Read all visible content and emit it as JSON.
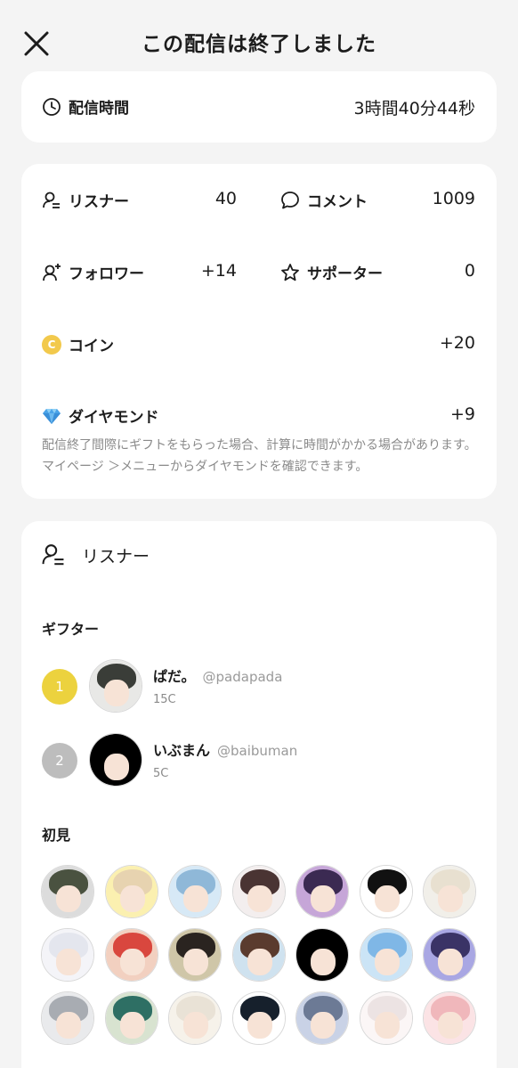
{
  "header": {
    "title": "この配信は終了しました"
  },
  "duration": {
    "label": "配信時間",
    "value": "3時間40分44秒"
  },
  "stats": {
    "listeners": {
      "label": "リスナー",
      "value": "40"
    },
    "comments": {
      "label": "コメント",
      "value": "1009"
    },
    "followers": {
      "label": "フォロワー",
      "value": "+14"
    },
    "supporters": {
      "label": "サポーター",
      "value": "0"
    },
    "coins": {
      "label": "コイン",
      "value": "+20",
      "icon_letter": "C"
    },
    "diamonds": {
      "label": "ダイヤモンド",
      "value": "+9"
    },
    "note": "配信終了間際にギフトをもらった場合、計算に時間がかかる場合があります。マイページ ＞メニューからダイヤモンドを確認できます。"
  },
  "listeners_section": {
    "title": "リスナー",
    "gifters_heading": "ギフター",
    "gifters": [
      {
        "rank": "1",
        "name": "ぱだ。",
        "handle": "@padapada",
        "coins": "15C",
        "rank_color": "#ecd23e",
        "hair_color": "#3a3d38"
      },
      {
        "rank": "2",
        "name": "いぶまん",
        "handle": "@baibuman",
        "coins": "5C",
        "rank_color": "#bdbdbd",
        "hair_color": "#000000"
      }
    ],
    "first_time_heading": "初見",
    "first_time_avatars": [
      {
        "hair": "#4a5240",
        "bg": "#dcdcdc"
      },
      {
        "hair": "#e7d3b0",
        "bg": "#fbf0b0"
      },
      {
        "hair": "#8fb8d8",
        "bg": "#d7e9f6"
      },
      {
        "hair": "#4a3433",
        "bg": "#f3eeee"
      },
      {
        "hair": "#3b2a52",
        "bg": "#c6a6d8"
      },
      {
        "hair": "#111111",
        "bg": "#ffffff"
      },
      {
        "hair": "#e8e0d0",
        "bg": "#f1efe9"
      },
      {
        "hair": "#e4e6ee",
        "bg": "#f4f4f8"
      },
      {
        "hair": "#d9473e",
        "bg": "#f2d0c0"
      },
      {
        "hair": "#2a2420",
        "bg": "#cfc6a8"
      },
      {
        "hair": "#5a3b2e",
        "bg": "#cfe2ef"
      },
      {
        "hair": "#000000",
        "bg": "#000000"
      },
      {
        "hair": "#7fb7e6",
        "bg": "#cbe4f6"
      },
      {
        "hair": "#3a3366",
        "bg": "#a9a7e3"
      },
      {
        "hair": "#a8acb2",
        "bg": "#e9eaec"
      },
      {
        "hair": "#2e6f64",
        "bg": "#d8e3d0"
      },
      {
        "hair": "#e9e2d6",
        "bg": "#f6f2ea"
      },
      {
        "hair": "#16202c",
        "bg": "#ffffff"
      },
      {
        "hair": "#6c7a95",
        "bg": "#c9d2e6"
      },
      {
        "hair": "#ece3e3",
        "bg": "#fbf6f6"
      },
      {
        "hair": "#f0b7bb",
        "bg": "#fbe3e5"
      }
    ]
  },
  "colors": {
    "accent_gold": "#ecd23e",
    "diamond": "#4aa3e8"
  }
}
